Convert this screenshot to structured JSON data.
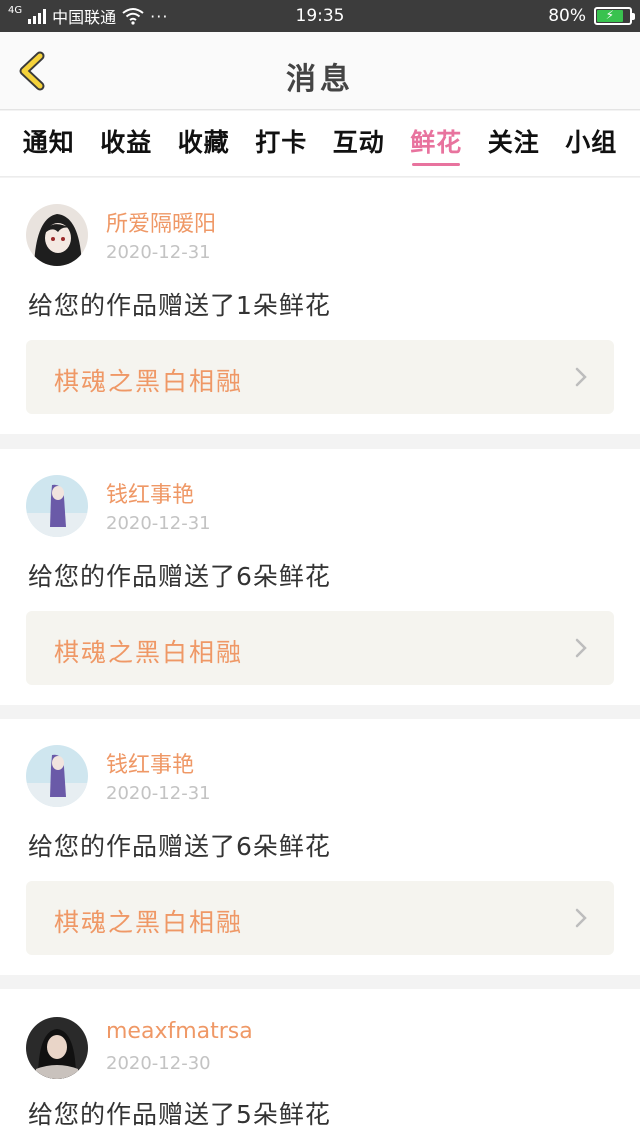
{
  "status_bar": {
    "network": "4G",
    "carrier": "中国联通",
    "more": "···",
    "time": "19:35",
    "battery": "80%",
    "battery_level": 0.8
  },
  "header": {
    "title": "消息"
  },
  "tabs": [
    {
      "label": "通知"
    },
    {
      "label": "收益"
    },
    {
      "label": "收藏"
    },
    {
      "label": "打卡"
    },
    {
      "label": "互动"
    },
    {
      "label": "鲜花"
    },
    {
      "label": "关注"
    },
    {
      "label": "小组"
    }
  ],
  "active_tab": "鲜花",
  "notifications": [
    {
      "username": "所爱隔暖阳",
      "date": "2020-12-31",
      "message": "给您的作品赠送了1朵鲜花",
      "work_title": "棋魂之黑白相融"
    },
    {
      "username": "钱红事艳",
      "date": "2020-12-31",
      "message": "给您的作品赠送了6朵鲜花",
      "work_title": "棋魂之黑白相融"
    },
    {
      "username": "钱红事艳",
      "date": "2020-12-31",
      "message": "给您的作品赠送了6朵鲜花",
      "work_title": "棋魂之黑白相融"
    },
    {
      "username": "meaxfmatrsa",
      "date": "2020-12-30",
      "message": "给您的作品赠送了5朵鲜花"
    }
  ],
  "colors": {
    "accent_pink": "#e8739e",
    "username_orange": "#ef9866",
    "back_arrow_yellow": "#f5d23a",
    "battery_green": "#39c24f"
  }
}
